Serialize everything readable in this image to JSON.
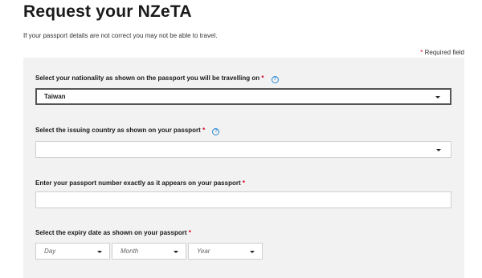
{
  "header": {
    "title": "Request your NZeTA",
    "intro": "If your passport details are not correct you may not be able to travel.",
    "required_star": "*",
    "required_note": "Required field"
  },
  "form": {
    "nationality": {
      "label": "Select your nationality as shown on the passport you will be travelling on",
      "star": "*",
      "help_glyph": "?",
      "value": "Taiwan",
      "icon": "chevron-down-icon"
    },
    "issuing_country": {
      "label": "Select the issuing country as shown on your passport",
      "star": "*",
      "help_glyph": "?",
      "value": "",
      "icon": "chevron-down-icon"
    },
    "passport_number": {
      "label": "Enter your passport number exactly as it appears on your passport",
      "star": "*",
      "value": ""
    },
    "expiry_date": {
      "label": "Select the expiry date as shown on your passport",
      "star": "*",
      "day_placeholder": "Day",
      "month_placeholder": "Month",
      "year_placeholder": "Year"
    }
  },
  "colors": {
    "required": "#d0021b",
    "help": "#2b8ad6",
    "panel_bg": "#f2f2f2"
  }
}
